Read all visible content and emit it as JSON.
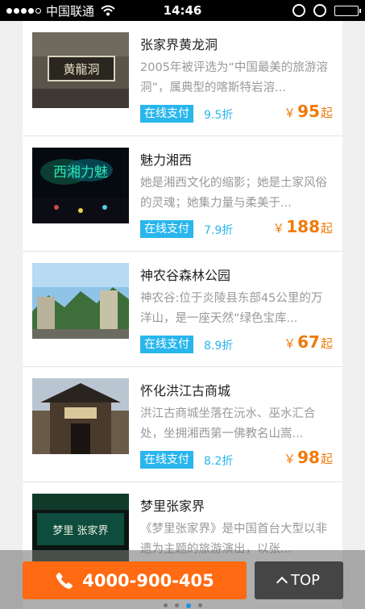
{
  "status_bar": {
    "carrier": "中国联通",
    "time": "14:46",
    "signal_icon": "signal-dots-icon",
    "wifi_icon": "wifi-icon",
    "battery_level": 0.95
  },
  "items": [
    {
      "title": "张家界黄龙洞",
      "description": "2005年被评选为“中国最美的旅游溶洞”，属典型的喀斯特岩溶...",
      "pay_label": "在线支付",
      "discount": "9.5折",
      "currency": "￥",
      "price": "95",
      "price_suffix": "起",
      "thumb_text": "黄龍洞"
    },
    {
      "title": "魅力湘西",
      "description": "她是湘西文化的缩影；她是土家风俗的灵魂；她集力量与柔美于...",
      "pay_label": "在线支付",
      "discount": "7.9折",
      "currency": "￥",
      "price": "188",
      "price_suffix": "起",
      "thumb_text": "西湘力魅"
    },
    {
      "title": "神农谷森林公园",
      "description": "神农谷:位于炎陵县东部45公里的万洋山，是一座天然“绿色宝库...",
      "pay_label": "在线支付",
      "discount": "8.9折",
      "currency": "￥",
      "price": "67",
      "price_suffix": "起"
    },
    {
      "title": "怀化洪江古商城",
      "description": "洪江古商城坐落在沅水、巫水汇合处，坐拥湘西第一佛教名山嵩...",
      "pay_label": "在线支付",
      "discount": "8.2折",
      "currency": "￥",
      "price": "98",
      "price_suffix": "起"
    },
    {
      "title": "梦里张家界",
      "description": "《梦里张家界》是中国首台大型以非遗为主题的旅游演出，以张...",
      "thumb_text": "梦里 张家界"
    }
  ],
  "bottom_bar": {
    "phone_number": "4000-900-405",
    "phone_icon": "phone-icon",
    "top_label": "TOP",
    "top_icon": "chevron-up-icon",
    "pager_count": 4,
    "pager_active": 2
  },
  "colors": {
    "accent_blue": "#29b6ec",
    "price_orange": "#f07a0c",
    "phone_button": "#ff6a12"
  }
}
